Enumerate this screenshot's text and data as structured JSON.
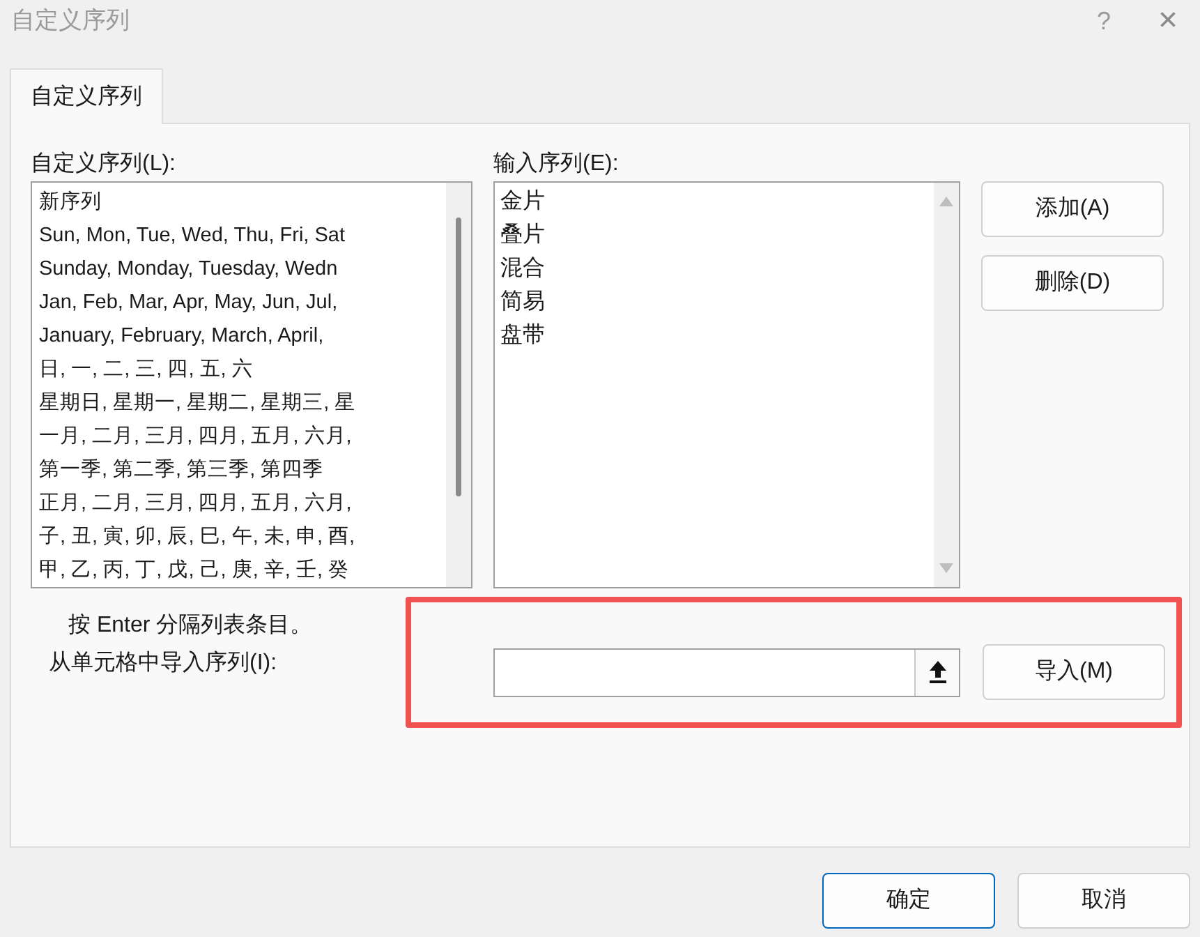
{
  "window": {
    "title": "自定义序列",
    "help": "?",
    "close": "×"
  },
  "tabs": [
    {
      "label": "自定义序列",
      "selected": true
    }
  ],
  "custom_lists": {
    "label": "自定义序列(L):",
    "items": [
      {
        "text": "新序列",
        "selected": false
      },
      {
        "text": "Sun, Mon, Tue, Wed, Thu, Fri, Sat",
        "selected": false
      },
      {
        "text": "Sunday, Monday, Tuesday, Wedn",
        "selected": false
      },
      {
        "text": "Jan, Feb, Mar, Apr, May, Jun, Jul,",
        "selected": false
      },
      {
        "text": "January, February, March, April,",
        "selected": false
      },
      {
        "text": "日, 一, 二, 三, 四, 五, 六",
        "selected": false
      },
      {
        "text": "星期日, 星期一, 星期二, 星期三, 星",
        "selected": false
      },
      {
        "text": "一月, 二月, 三月, 四月, 五月, 六月,",
        "selected": false
      },
      {
        "text": "第一季, 第二季, 第三季, 第四季",
        "selected": false
      },
      {
        "text": "正月, 二月, 三月, 四月, 五月, 六月,",
        "selected": false
      },
      {
        "text": "子, 丑, 寅, 卯, 辰, 巳, 午, 未, 申, 酉,",
        "selected": false
      },
      {
        "text": "甲, 乙, 丙, 丁, 戊, 己, 庚, 辛, 壬, 癸",
        "selected": false
      }
    ]
  },
  "entries": {
    "label": "输入序列(E):",
    "lines": [
      "金片",
      "叠片",
      "混合",
      "简易",
      "盘带"
    ]
  },
  "side_buttons": [
    "添加(A)",
    "删除(D)"
  ],
  "hint": "按 Enter 分隔列表条目。",
  "import": {
    "label": "从单元格中导入序列(I):",
    "button": "导入(M)",
    "highlighted": true
  },
  "footer_buttons": [
    {
      "label": "确定",
      "default": true
    },
    {
      "label": "取消",
      "default": false
    }
  ]
}
